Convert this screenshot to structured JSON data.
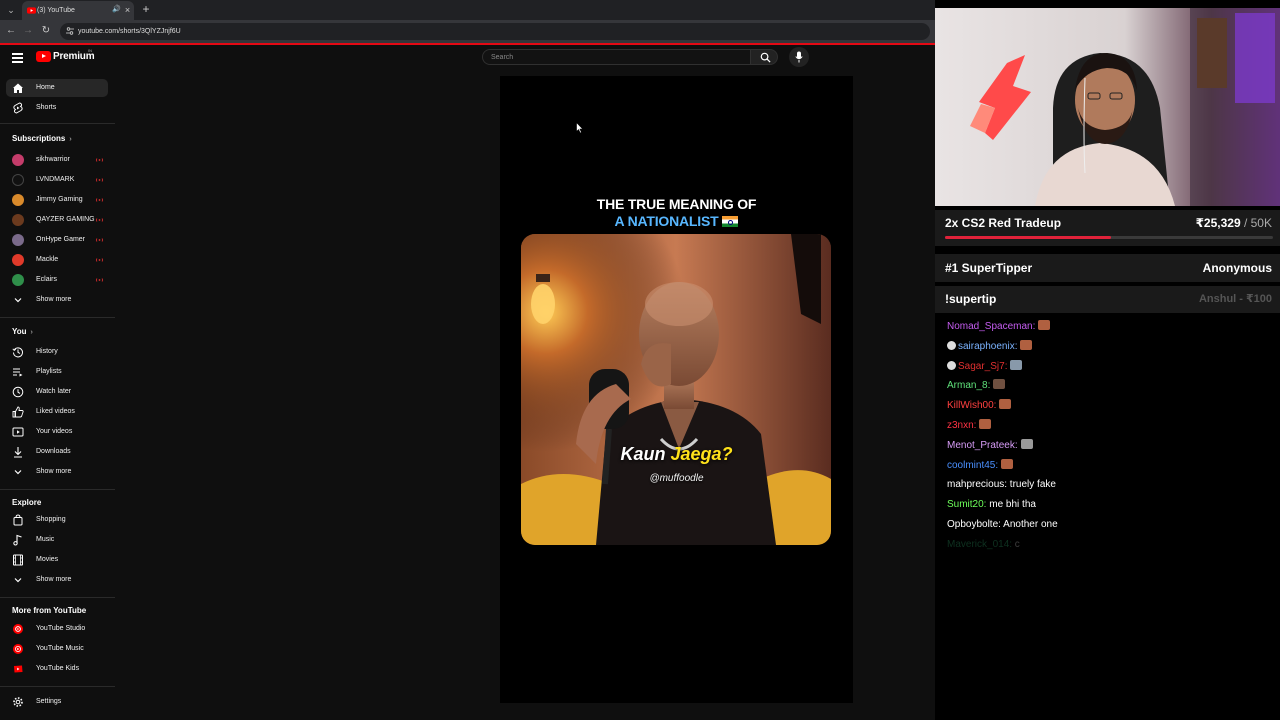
{
  "browser": {
    "tab_title": "(3) YouTube",
    "url": "youtube.com/shorts/3QlYZJnjf6U"
  },
  "header": {
    "logo_text": "Premium",
    "country": "IN",
    "search_placeholder": "Search"
  },
  "sidebar": {
    "main": [
      {
        "label": "Home",
        "icon": "home-icon",
        "active": true
      },
      {
        "label": "Shorts",
        "icon": "shorts-icon",
        "active": false
      }
    ],
    "subscriptions_heading": "Subscriptions",
    "subscriptions": [
      {
        "label": "sikhwarrior",
        "avatar_color": "#c43c6a"
      },
      {
        "label": "LVNDMARK",
        "avatar_color": "#111111"
      },
      {
        "label": "Jimmy Gaming",
        "avatar_color": "#d98a2b"
      },
      {
        "label": "QAYZER GAMING",
        "avatar_color": "#6b3a1e"
      },
      {
        "label": "OnHype Gamer",
        "avatar_color": "#7a6a8a"
      },
      {
        "label": "Mackle",
        "avatar_color": "#e03a2a"
      },
      {
        "label": "Eclairs",
        "avatar_color": "#2f8f4a"
      }
    ],
    "subs_show_more": "Show more",
    "you_heading": "You",
    "you_items": [
      {
        "label": "History",
        "icon": "history-icon"
      },
      {
        "label": "Playlists",
        "icon": "playlists-icon"
      },
      {
        "label": "Watch later",
        "icon": "watch-later-icon"
      },
      {
        "label": "Liked videos",
        "icon": "thumbs-up-icon"
      },
      {
        "label": "Your videos",
        "icon": "your-videos-icon"
      },
      {
        "label": "Downloads",
        "icon": "download-icon"
      }
    ],
    "you_show_more": "Show more",
    "explore_heading": "Explore",
    "explore_items": [
      {
        "label": "Shopping",
        "icon": "shopping-bag-icon"
      },
      {
        "label": "Music",
        "icon": "music-note-icon"
      },
      {
        "label": "Movies",
        "icon": "movies-icon"
      }
    ],
    "explore_show_more": "Show more",
    "more_heading": "More from YouTube",
    "more_items": [
      {
        "label": "YouTube Studio",
        "icon": "youtube-studio-icon"
      },
      {
        "label": "YouTube Music",
        "icon": "youtube-music-icon"
      },
      {
        "label": "YouTube Kids",
        "icon": "youtube-kids-icon"
      }
    ],
    "settings": "Settings"
  },
  "short": {
    "title_line1": "THE TRUE MEANING OF",
    "title_line2": "A NATIONALIST",
    "caption_word1": "Kaun",
    "caption_word2": "Jaega?",
    "handle": "@muffoodle"
  },
  "stream": {
    "goal_title": "2x CS2 Red Tradeup",
    "goal_current": "₹25,329",
    "goal_target": "/ 50K",
    "goal_progress": 0.5066,
    "accent": "#e0223a",
    "tipper_label": "#1 SuperTipper",
    "tipper_name": "Anonymous",
    "supertip_label": "!supertip",
    "supertip_last": "Anshul - ₹100",
    "chat": [
      {
        "user": "Nomad_Spaceman:",
        "color": "#c55cf0",
        "msg": "",
        "emote": "#b06040",
        "badge": false
      },
      {
        "user": "sairaphoenix:",
        "color": "#7bb3ff",
        "msg": "",
        "emote": "#b06040",
        "badge": true
      },
      {
        "user": "Sagar_Sj7:",
        "color": "#e03030",
        "msg": "",
        "emote": "#8899aa",
        "badge": true
      },
      {
        "user": "Arman_8:",
        "color": "#5fe07a",
        "msg": "",
        "emote": "#705040",
        "badge": false
      },
      {
        "user": "KillWish00:",
        "color": "#ff4040",
        "msg": "",
        "emote": "#b06040",
        "badge": false
      },
      {
        "user": "z3nxn:",
        "color": "#ff3344",
        "msg": "",
        "emote": "#b06040",
        "badge": false
      },
      {
        "user": "Menot_Prateek:",
        "color": "#d79cf7",
        "msg": "",
        "emote": "#999999",
        "badge": false
      },
      {
        "user": "coolmint45:",
        "color": "#4a90ff",
        "msg": "",
        "emote": "#b06040",
        "badge": false
      },
      {
        "user": "mahprecious:",
        "color": "#ffffff",
        "msg": "truely fake",
        "emote": "",
        "badge": false
      },
      {
        "user": "Sumit20:",
        "color": "#6dff5a",
        "msg": "me bhi tha",
        "emote": "",
        "badge": false
      },
      {
        "user": "Opboybolte:",
        "color": "#ffffff",
        "msg": "Another one",
        "emote": "",
        "badge": false
      },
      {
        "user": "Maverick_014:",
        "color": "#1f6b45",
        "msg": "c",
        "emote": "",
        "badge": false
      }
    ]
  }
}
